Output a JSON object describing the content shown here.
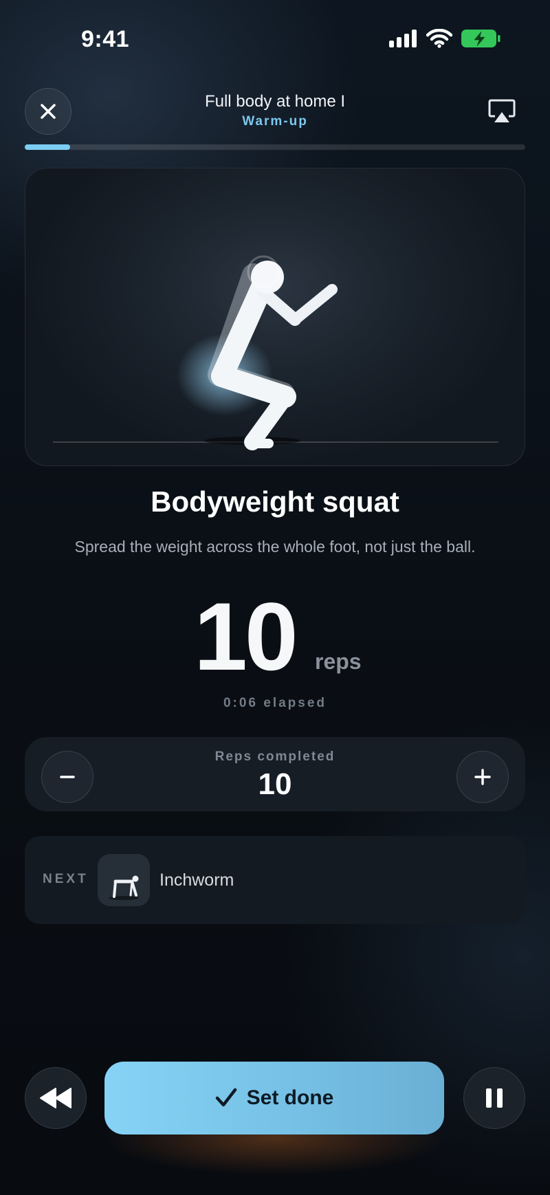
{
  "status_bar": {
    "time": "9:41"
  },
  "header": {
    "title": "Full body at home I",
    "subtitle": "Warm-up",
    "progress_fraction": 0.09
  },
  "exercise": {
    "name": "Bodyweight squat",
    "tip": "Spread the weight across the whole foot, not just the ball.",
    "target_reps": "10",
    "unit": "reps",
    "elapsed": "0:06 elapsed"
  },
  "reps_panel": {
    "label": "Reps completed",
    "value": "10"
  },
  "next": {
    "label": "NEXT",
    "name": "Inchworm"
  },
  "controls": {
    "done_label": "Set done"
  },
  "colors": {
    "accent": "#7ccdf3",
    "subtitle": "#7cc8ee",
    "battery": "#34c759"
  },
  "icons": [
    "close-icon",
    "airplay-icon",
    "minus-icon",
    "plus-icon",
    "rewind-icon",
    "check-icon",
    "pause-icon",
    "signal-icon",
    "wifi-icon",
    "battery-icon"
  ]
}
